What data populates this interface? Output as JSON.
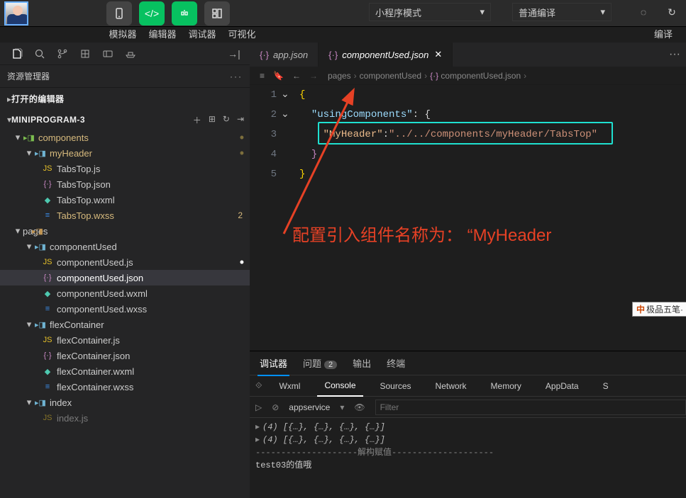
{
  "toolbar_labels": [
    "模拟器",
    "编辑器",
    "调试器",
    "可视化"
  ],
  "drop1": {
    "text": "小程序模式"
  },
  "drop2": {
    "text": "普通编译"
  },
  "compile_label": "编译",
  "explorer_title": "资源管理器",
  "open_editors": "打开的编辑器",
  "project_name": "MINIPROGRAM-3",
  "tree": {
    "components": "components",
    "myHeader": "myHeader",
    "TabsTop_js": "TabsTop.js",
    "TabsTop_json": "TabsTop.json",
    "TabsTop_wxml": "TabsTop.wxml",
    "TabsTop_wxss": "TabsTop.wxss",
    "TabsTop_wxss_badge": "2",
    "pages": "pages",
    "componentUsed": "componentUsed",
    "componentUsed_js": "componentUsed.js",
    "componentUsed_json": "componentUsed.json",
    "componentUsed_wxml": "componentUsed.wxml",
    "componentUsed_wxss": "componentUsed.wxss",
    "flexContainer": "flexContainer",
    "flexContainer_js": "flexContainer.js",
    "flexContainer_json": "flexContainer.json",
    "flexContainer_wxml": "flexContainer.wxml",
    "flexContainer_wxss": "flexContainer.wxss",
    "index": "index",
    "index_js": "index.js"
  },
  "tabs": {
    "app_json": "app.json",
    "comp_json": "componentUsed.json"
  },
  "crumb": {
    "pages": "pages",
    "componentUsed": "componentUsed",
    "file": "componentUsed.json"
  },
  "code": {
    "l1": "{",
    "l2a": "\"usingComponents\"",
    "l2b": ": {",
    "l3a": "\"MyHeader\"",
    "l3b": ":",
    "l3c": "\"../../components/myHeader/TabsTop\"",
    "l4": "}",
    "l5": "}"
  },
  "bigtext": "配置引入组件名称为：  “MyHeader",
  "ime": "极品五笔",
  "console": {
    "tabs": [
      "调试器",
      "问题",
      "输出",
      "终端"
    ],
    "badge": "2",
    "subtabs": [
      "Wxml",
      "Console",
      "Sources",
      "Network",
      "Memory",
      "AppData",
      "S"
    ],
    "service": "appservice",
    "filter_ph": "Filter",
    "l1": "(4) [{…}, {…}, {…}, {…}]",
    "l2": "(4) [{…}, {…}, {…}, {…}]",
    "l3": "--------------------解构赋值--------------------",
    "l4": "test03的值哦"
  }
}
